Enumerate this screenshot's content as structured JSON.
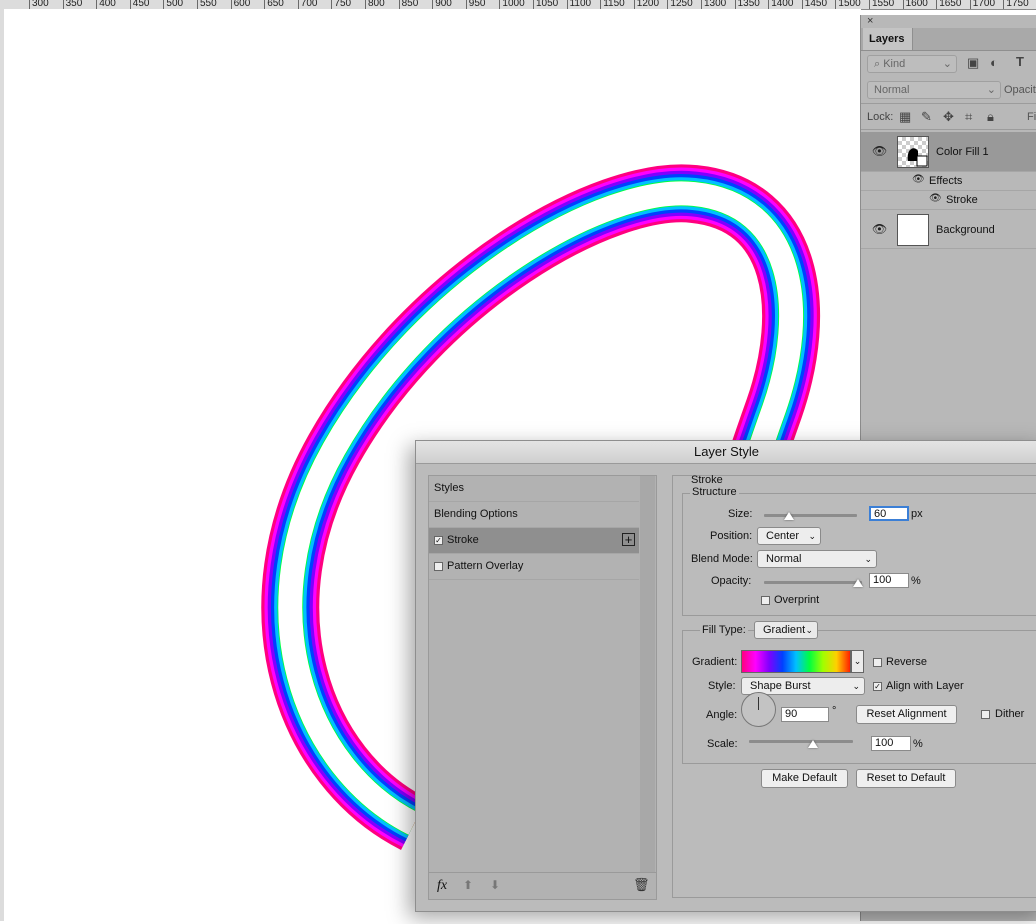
{
  "ruler": {
    "labels": [
      "300",
      "350",
      "400",
      "450",
      "500",
      "550",
      "600",
      "650",
      "700",
      "750",
      "800",
      "850",
      "900",
      "950",
      "1000",
      "1050",
      "1100",
      "1150",
      "1200",
      "1250",
      "1300",
      "1350",
      "1400",
      "1450",
      "1500",
      "1550",
      "1600",
      "1650",
      "1700",
      "1750"
    ]
  },
  "canvas": {
    "gradient_colors": [
      "#ff0080",
      "#ff00ff",
      "#8000ff",
      "#0040ff",
      "#00c0ff",
      "#00ff40",
      "#a0ff00",
      "#ffd000",
      "#ff2000"
    ]
  },
  "layers_panel": {
    "close_glyph": "×",
    "tab_label": "Layers",
    "kind_filter": "Kind",
    "blend_mode": "Normal",
    "opacity_label": "Opacity",
    "lock_label": "Lock:",
    "fill_label": "Fi",
    "layers": [
      {
        "name": "Color Fill 1",
        "effects_label": "Effects",
        "effect": "Stroke"
      },
      {
        "name": "Background"
      }
    ]
  },
  "dialog": {
    "title": "Layer Style",
    "styles_header": "Styles",
    "blending_options": "Blending Options",
    "style_items": [
      {
        "label": "Stroke",
        "checked": true
      },
      {
        "label": "Pattern Overlay",
        "checked": false
      }
    ],
    "add_glyph": "+",
    "fx_label": "fx",
    "stroke": {
      "section_title": "Stroke",
      "structure_title": "Structure",
      "size_label": "Size:",
      "size_value": "60",
      "size_unit": "px",
      "size_slider_fraction": 0.27,
      "position_label": "Position:",
      "position_value": "Center",
      "blend_mode_label": "Blend Mode:",
      "blend_mode_value": "Normal",
      "opacity_label": "Opacity:",
      "opacity_value": "100",
      "opacity_unit": "%",
      "overprint_label": "Overprint",
      "fill_type_label": "Fill Type:",
      "fill_type_value": "Gradient",
      "gradient_label": "Gradient:",
      "reverse_label": "Reverse",
      "style_label": "Style:",
      "style_value": "Shape Burst",
      "align_label": "Align with Layer",
      "angle_label": "Angle:",
      "angle_value": "90",
      "angle_unit": "°",
      "reset_alignment": "Reset Alignment",
      "dither_label": "Dither",
      "scale_label": "Scale:",
      "scale_value": "100",
      "scale_unit": "%",
      "make_default": "Make Default",
      "reset_default": "Reset to Default"
    }
  }
}
